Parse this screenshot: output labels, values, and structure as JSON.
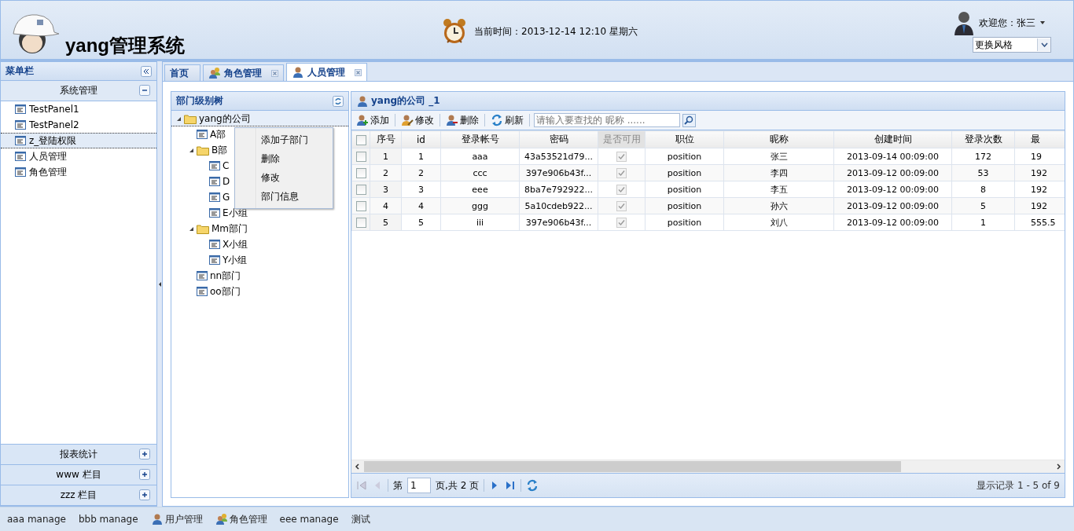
{
  "header": {
    "title": "yang管理系统",
    "time": "当前时间：2013-12-14 12:10 星期六",
    "welcome": "欢迎您：张三",
    "style_select": "更换风格"
  },
  "menu": {
    "title": "菜单栏",
    "sections": [
      {
        "title": "系统管理",
        "expanded": true,
        "items": [
          {
            "label": "TestPanel1",
            "selected": false
          },
          {
            "label": "TestPanel2",
            "selected": false
          },
          {
            "label": "z_登陆权限",
            "selected": true
          },
          {
            "label": "人员管理",
            "selected": false
          },
          {
            "label": "角色管理",
            "selected": false
          }
        ]
      },
      {
        "title": "报表统计",
        "expanded": false
      },
      {
        "title": "www 栏目",
        "expanded": false
      },
      {
        "title": "zzz 栏目",
        "expanded": false
      }
    ]
  },
  "tabs": [
    {
      "label": "首页",
      "closable": false,
      "selected": false
    },
    {
      "label": "角色管理",
      "closable": true,
      "selected": false
    },
    {
      "label": "人员管理",
      "closable": true,
      "selected": true
    }
  ],
  "tree_panel": {
    "title": "部门级别树",
    "nodes": [
      {
        "label": "yang的公司",
        "kind": "folder",
        "expanded": true,
        "selected": true,
        "children": [
          {
            "label": "A部",
            "kind": "leaf",
            "selected": false
          },
          {
            "label": "B部",
            "kind": "folder",
            "expanded": true,
            "selected": false,
            "children": [
              {
                "label": "C",
                "kind": "leaf",
                "selected": false
              },
              {
                "label": "D",
                "kind": "leaf",
                "selected": false
              },
              {
                "label": "G",
                "kind": "leaf",
                "selected": false
              },
              {
                "label": "E小组",
                "kind": "leaf",
                "selected": false
              }
            ]
          },
          {
            "label": "Mm部门",
            "kind": "folder",
            "expanded": true,
            "selected": false,
            "children": [
              {
                "label": "X小组",
                "kind": "leaf",
                "selected": false
              },
              {
                "label": "Y小组",
                "kind": "leaf",
                "selected": false
              }
            ]
          },
          {
            "label": "nn部门",
            "kind": "leaf",
            "selected": false
          },
          {
            "label": "oo部门",
            "kind": "leaf",
            "selected": false
          }
        ]
      }
    ]
  },
  "context_menu": [
    "添加子部门",
    "删除",
    "修改",
    "部门信息"
  ],
  "grid": {
    "title": "yang的公司 _1",
    "toolbar": [
      "添加",
      "修改",
      "删除",
      "刷新"
    ],
    "search": {
      "placeholder": "请输入要查找的 昵称 ......"
    },
    "select_all_checked": false,
    "columns": [
      "序号",
      "id",
      "登录帐号",
      "密码",
      "是否可用",
      "职位",
      "昵称",
      "创建时间",
      "登录次数",
      "最"
    ],
    "rows": [
      {
        "checked": false,
        "available": true,
        "cells": [
          "1",
          "1",
          "aaa",
          "43a53521d79...",
          "",
          "position",
          "张三",
          "2013-09-14 00:09:00",
          "172",
          "19"
        ]
      },
      {
        "checked": false,
        "available": true,
        "cells": [
          "2",
          "2",
          "ccc",
          "397e906b43f...",
          "",
          "position",
          "李四",
          "2013-09-12 00:09:00",
          "53",
          "192"
        ]
      },
      {
        "checked": false,
        "available": true,
        "cells": [
          "3",
          "3",
          "eee",
          "8ba7e792922...",
          "",
          "position",
          "李五",
          "2013-09-12 00:09:00",
          "8",
          "192"
        ]
      },
      {
        "checked": false,
        "available": true,
        "cells": [
          "4",
          "4",
          "ggg",
          "5a10cdeb922...",
          "",
          "position",
          "孙六",
          "2013-09-12 00:09:00",
          "5",
          "192"
        ]
      },
      {
        "checked": false,
        "available": true,
        "cells": [
          "5",
          "5",
          "iii",
          "397e906b43f...",
          "",
          "position",
          "刘八",
          "2013-09-12 00:09:00",
          "1",
          "555.5"
        ]
      }
    ],
    "pager": {
      "before": "第",
      "page": "1",
      "after": "页,共 2 页",
      "summary": "显示记录 1 - 5 of 9"
    }
  },
  "taskbar": [
    "aaa manage",
    "bbb manage",
    "用户管理",
    "角色管理",
    "eee manage",
    "测试"
  ]
}
